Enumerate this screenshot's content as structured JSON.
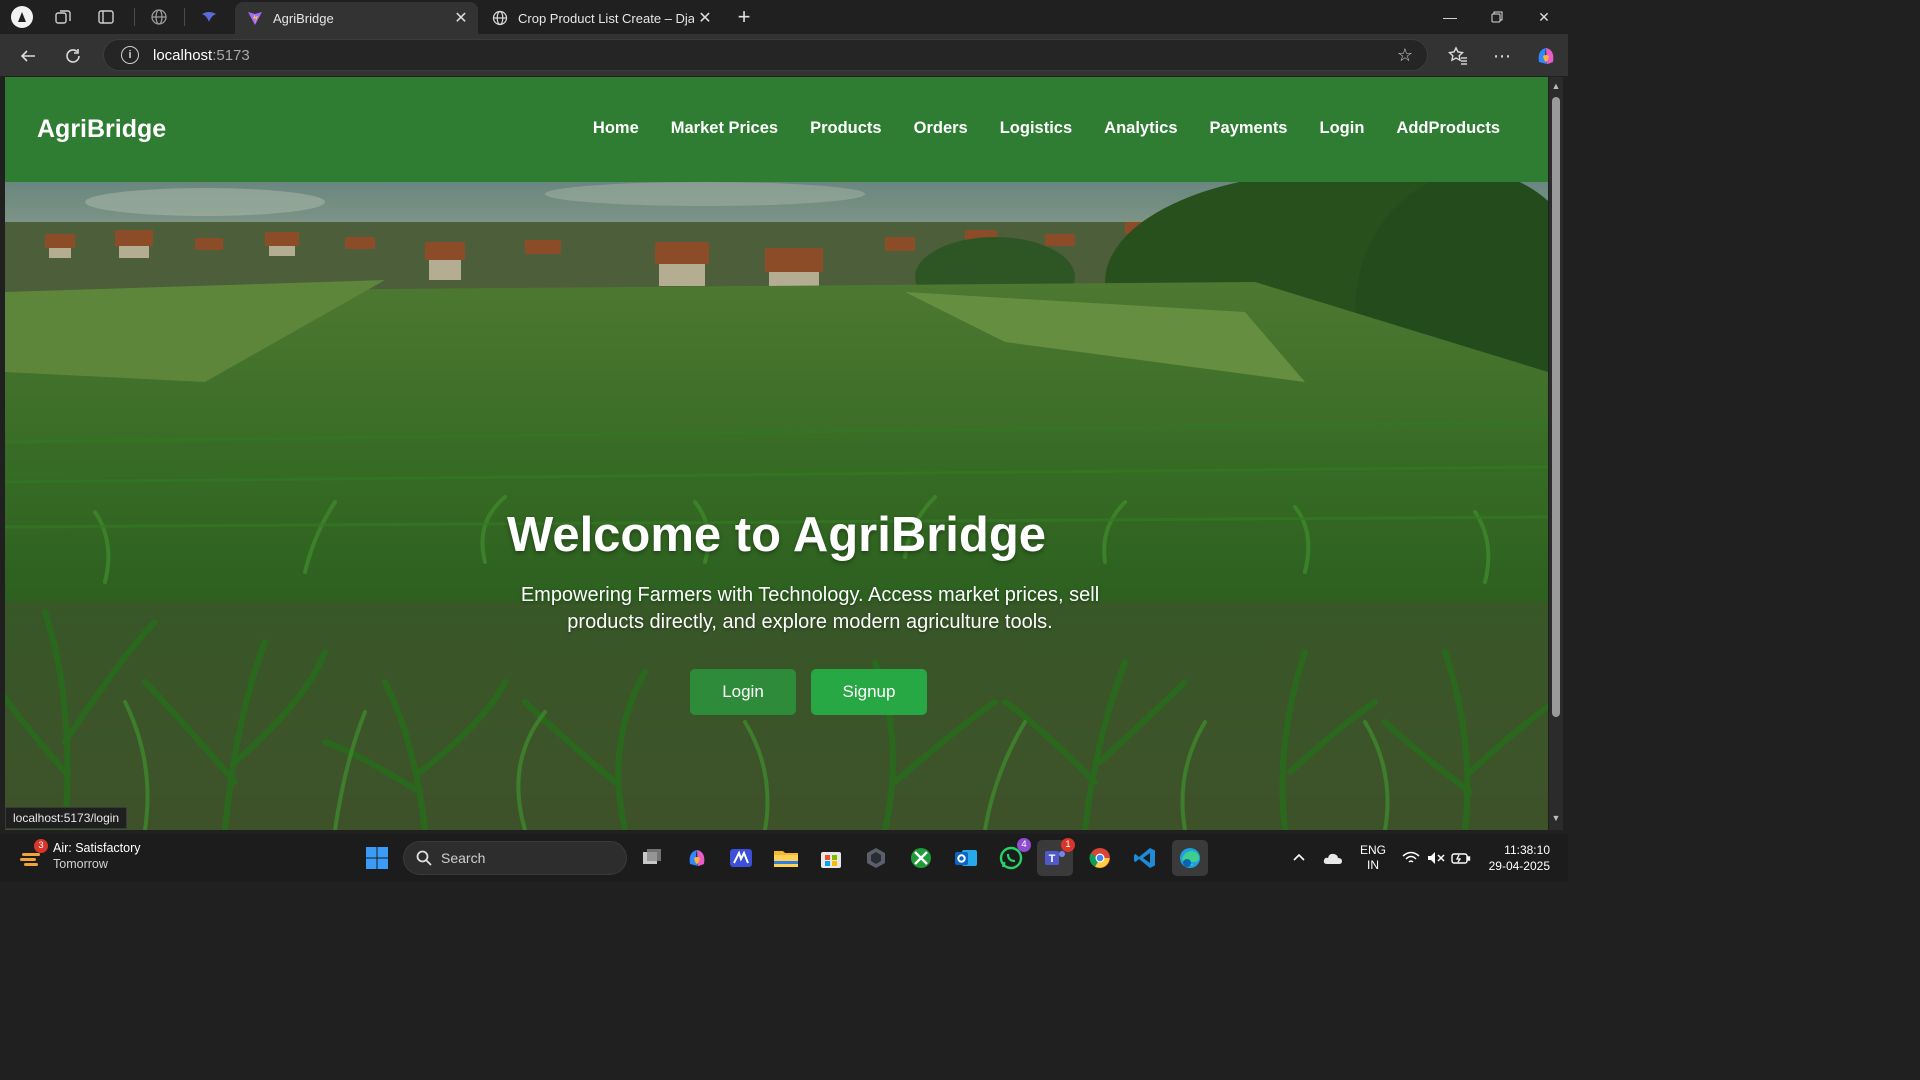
{
  "browser": {
    "tabs": [
      {
        "title": "AgriBridge",
        "active": true
      },
      {
        "title": "Crop Product List Create – Django",
        "active": false
      }
    ],
    "address": {
      "host": "localhost",
      "port": ":5173"
    },
    "status_url": "localhost:5173/login"
  },
  "site": {
    "brand": "AgriBridge",
    "nav": [
      "Home",
      "Market Prices",
      "Products",
      "Orders",
      "Logistics",
      "Analytics",
      "Payments",
      "Login",
      "AddProducts"
    ],
    "hero": {
      "title": "Welcome to AgriBridge",
      "subtitle": "Empowering Farmers with Technology. Access market prices, sell products directly, and explore modern agriculture tools.",
      "login_label": "Login",
      "signup_label": "Signup"
    }
  },
  "taskbar": {
    "weather": {
      "title": "Air: Satisfactory",
      "sub": "Tomorrow",
      "badge": "3"
    },
    "search_placeholder": "Search",
    "whatsapp_badge": "4",
    "teams_badge": "1",
    "lang_top": "ENG",
    "lang_bottom": "IN",
    "time": "11:38:10",
    "date": "29-04-2025"
  },
  "colors": {
    "header_green": "#2e7d32",
    "login_btn": "#2e8b3a",
    "signup_btn": "#28a745"
  }
}
